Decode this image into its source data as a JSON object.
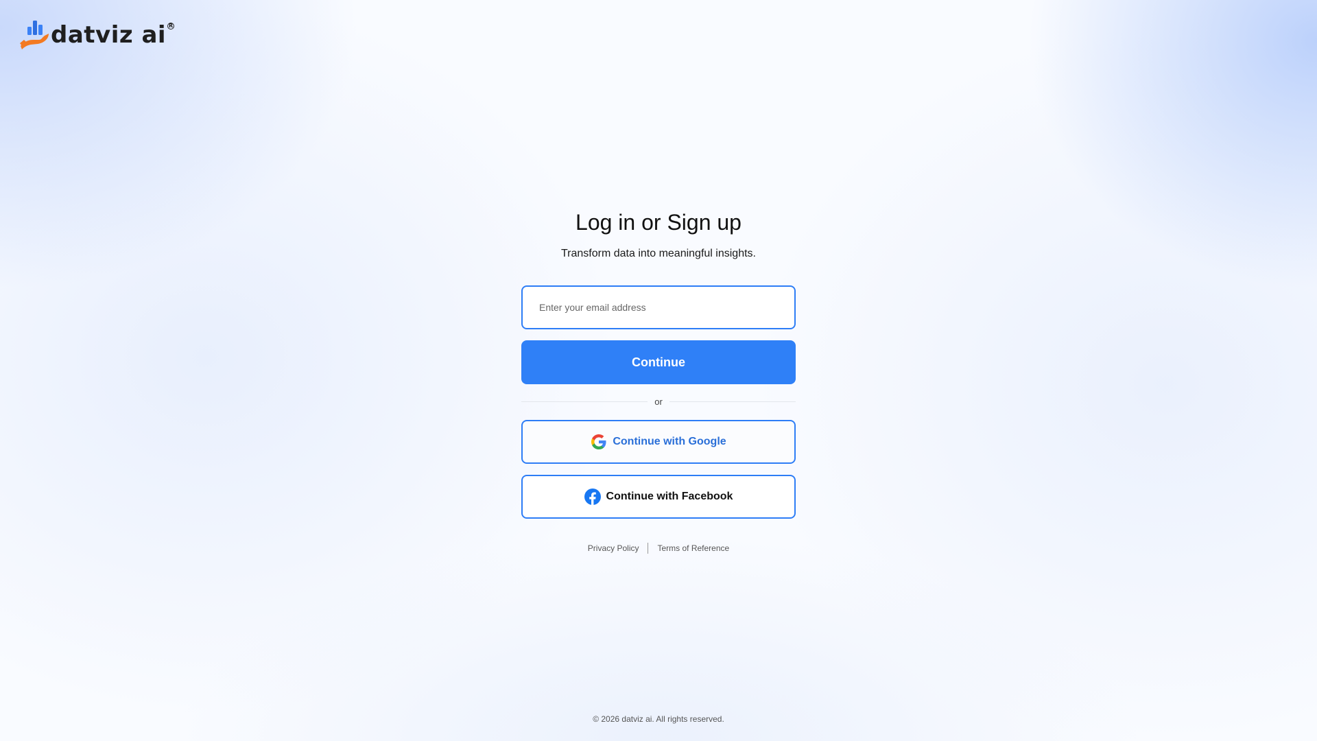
{
  "brand": {
    "name": "datviz ai",
    "registered_mark": "R",
    "colors": {
      "primary": "#2f80f7",
      "accent_orange": "#f37a22",
      "text": "#1f1f1f"
    }
  },
  "auth": {
    "title": "Log in or Sign up",
    "subtitle": "Transform data into meaningful insights.",
    "email": {
      "placeholder": "Enter your email address",
      "value": ""
    },
    "continue_label": "Continue",
    "divider_label": "or",
    "google_label": "Continue with Google",
    "facebook_label": "Continue with Facebook",
    "icons": [
      "google-icon",
      "facebook-icon"
    ]
  },
  "legal": {
    "privacy_label": "Privacy Policy",
    "terms_label": "Terms of Reference"
  },
  "footer": {
    "copyright": "© 2026 datviz ai. All rights reserved."
  }
}
